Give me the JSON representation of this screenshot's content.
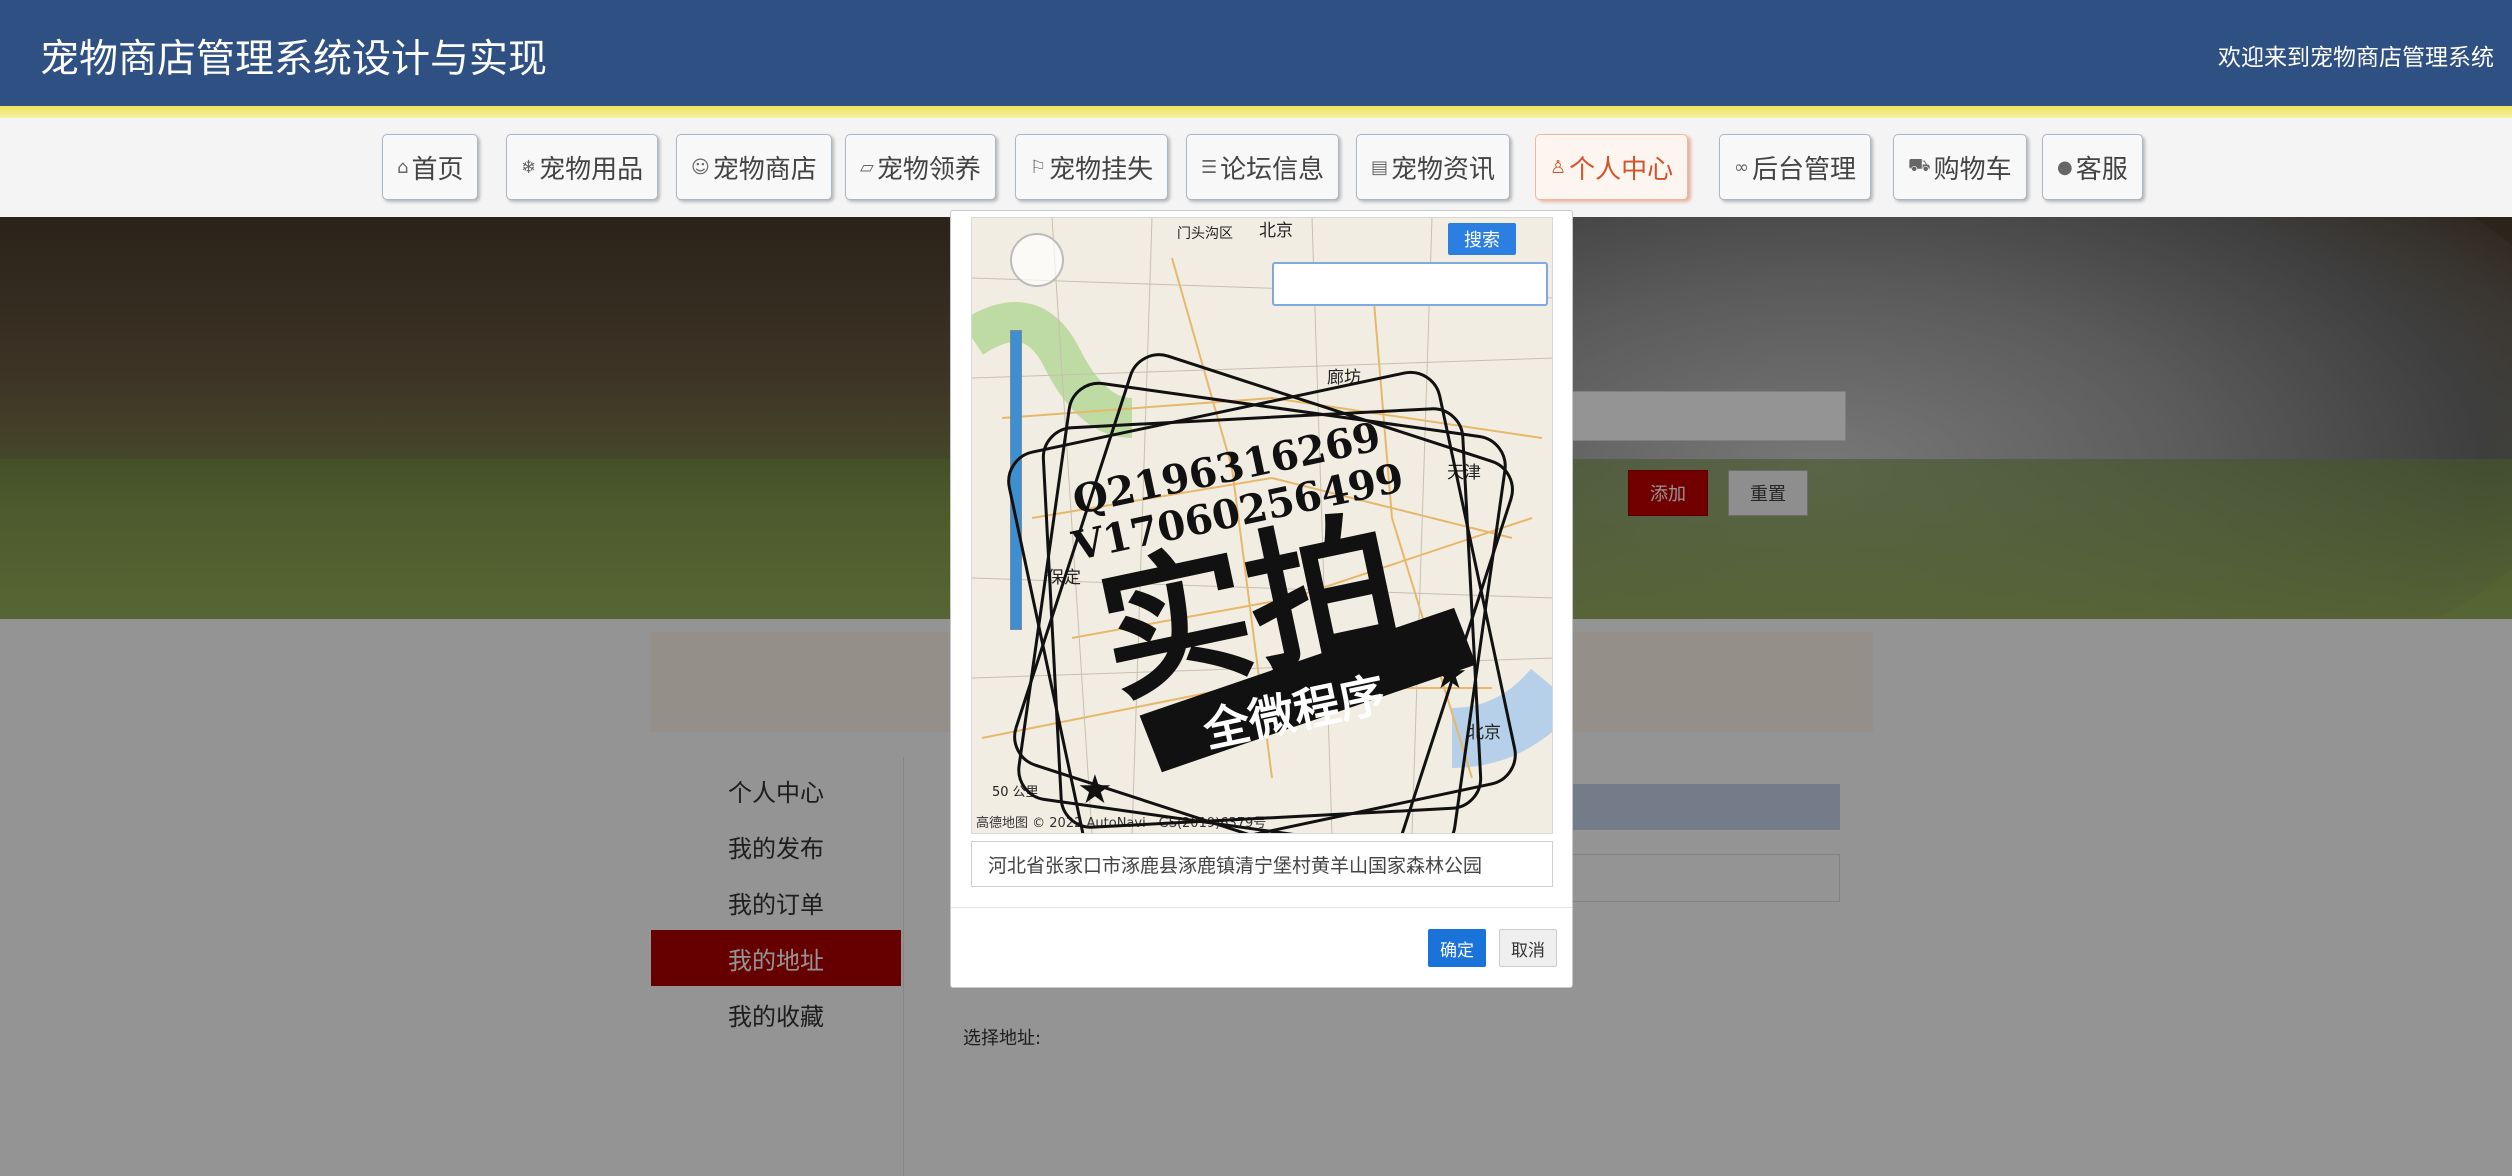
{
  "header": {
    "site_title": "宠物商店管理系统设计与实现",
    "welcome": "欢迎来到宠物商店管理系统",
    "bg_color": "#2f5083"
  },
  "nav": {
    "items": [
      {
        "label": "首页",
        "icon": "home-icon"
      },
      {
        "label": "宠物用品",
        "icon": "snowflake-icon"
      },
      {
        "label": "宠物商店",
        "icon": "pet-icon"
      },
      {
        "label": "宠物领养",
        "icon": "note-icon"
      },
      {
        "label": "宠物挂失",
        "icon": "flag-icon"
      },
      {
        "label": "论坛信息",
        "icon": "sliders-icon"
      },
      {
        "label": "宠物资讯",
        "icon": "news-icon"
      },
      {
        "label": "个人中心",
        "icon": "user-icon"
      },
      {
        "label": "后台管理",
        "icon": "link-icon"
      },
      {
        "label": "购物车",
        "icon": "cart-icon"
      },
      {
        "label": "客服",
        "icon": "service-icon"
      }
    ],
    "active_index": 7
  },
  "sidebar": {
    "items": [
      {
        "label": "个人中心"
      },
      {
        "label": "我的发布"
      },
      {
        "label": "我的订单"
      },
      {
        "label": "我的地址"
      },
      {
        "label": "我的收藏"
      }
    ],
    "active_index": 3,
    "active_color": "#b00000"
  },
  "form": {
    "address_label": "选择地址:",
    "address_placeholder": "选择地址",
    "add_label": "添加",
    "reset_label": "重置"
  },
  "modal": {
    "search_label": "搜索",
    "search_value": "",
    "map_cities": [
      "北京",
      "天津",
      "保定",
      "廊坊",
      "门头沟区",
      "北京"
    ],
    "map_copyright": "© 2022 AutoNavi - GS(2019)6379号",
    "map_scale": "50 公里",
    "map_brand": "高德地图",
    "selected_address": "河北省张家口市涿鹿县涿鹿镇清宁堡村黄羊山国家森林公园",
    "ok_label": "确定",
    "cancel_label": "取消"
  },
  "watermark": {
    "line1": "Q2196316269",
    "line2": "V17060256499",
    "main": "实拍",
    "sub": "全微程序"
  }
}
